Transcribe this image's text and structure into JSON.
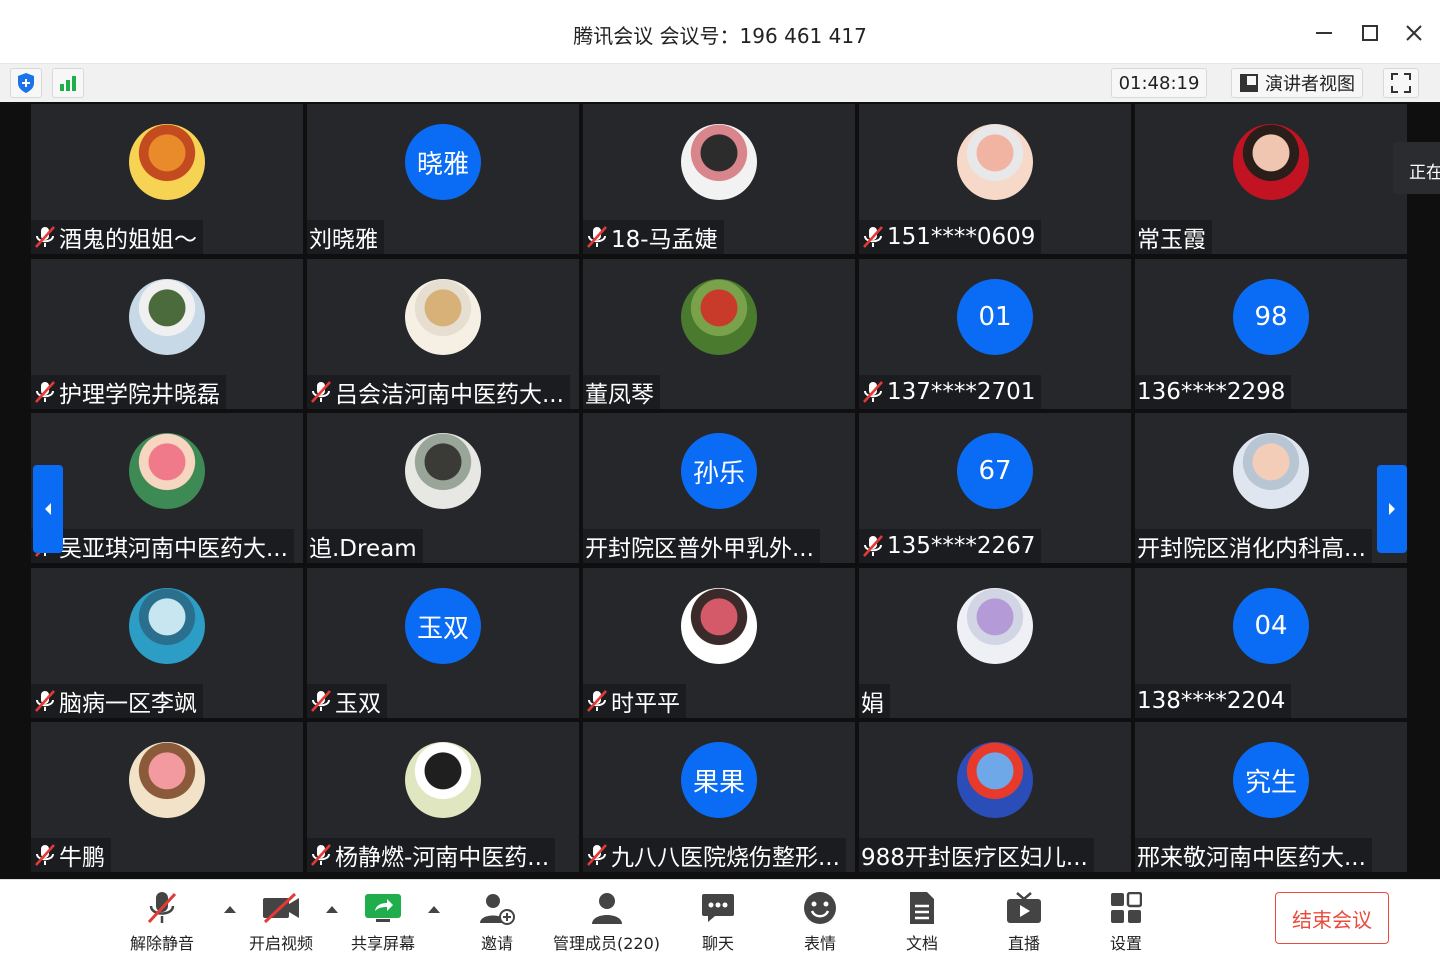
{
  "window": {
    "title": "腾讯会议 会议号：196 461 417"
  },
  "infobar": {
    "timer": "01:48:19",
    "presenter_view": "演讲者视图"
  },
  "speaking_label": "正在",
  "tiles": [
    {
      "name": "酒鬼的姐姐～",
      "muted": true,
      "avatar": "photo",
      "avatar_colors": [
        "#f7d354",
        "#e98b2a",
        "#c44a20"
      ]
    },
    {
      "name": "刘晓雅",
      "muted": false,
      "avatar": "text",
      "avatar_text": "晓雅"
    },
    {
      "name": "18-马孟婕",
      "muted": true,
      "avatar": "photo",
      "avatar_colors": [
        "#f2f2f2",
        "#2c2c2c",
        "#d8858c"
      ]
    },
    {
      "name": "151****0609",
      "muted": true,
      "avatar": "photo",
      "avatar_colors": [
        "#f6d9c9",
        "#f1b3a2",
        "#e8e8ea"
      ]
    },
    {
      "name": "常玉霞",
      "muted": false,
      "avatar": "photo",
      "avatar_colors": [
        "#c21322",
        "#f0c6b0",
        "#2a1e1a"
      ]
    },
    {
      "name": "护理学院井晓磊",
      "muted": true,
      "avatar": "photo",
      "avatar_colors": [
        "#c7d8e6",
        "#4b6b3c",
        "#f0f0f0"
      ]
    },
    {
      "name": "吕会洁河南中医药大...",
      "muted": true,
      "avatar": "photo",
      "avatar_colors": [
        "#f6efe3",
        "#d7b178",
        "#e7ded2"
      ]
    },
    {
      "name": "董凤琴",
      "muted": false,
      "avatar": "photo",
      "avatar_colors": [
        "#4a7a2e",
        "#c83a2a",
        "#7aa24a"
      ]
    },
    {
      "name": "137****2701",
      "muted": true,
      "avatar": "text",
      "avatar_text": "01"
    },
    {
      "name": "136****2298",
      "muted": false,
      "avatar": "text",
      "avatar_text": "98"
    },
    {
      "name": "吴亚琪河南中医药大...",
      "muted": true,
      "avatar": "photo",
      "avatar_colors": [
        "#3e8a54",
        "#f07a8a",
        "#f6d6c0"
      ]
    },
    {
      "name": "追.Dream",
      "muted": false,
      "avatar": "photo",
      "avatar_colors": [
        "#e7e7e4",
        "#3a3a36",
        "#9aa59a"
      ]
    },
    {
      "name": "开封院区普外甲乳外...",
      "muted": false,
      "avatar": "text",
      "avatar_text": "孙乐"
    },
    {
      "name": "135****2267",
      "muted": true,
      "avatar": "text",
      "avatar_text": "67"
    },
    {
      "name": "开封院区消化内科高...",
      "muted": false,
      "avatar": "photo",
      "avatar_colors": [
        "#dfe6f0",
        "#f3cdb8",
        "#b8c6d4"
      ]
    },
    {
      "name": "脑病一区李飒",
      "muted": true,
      "avatar": "photo",
      "avatar_colors": [
        "#2c9dc4",
        "#c8e6f0",
        "#2b6f8e"
      ]
    },
    {
      "name": "玉双",
      "muted": true,
      "avatar": "text",
      "avatar_text": "玉双"
    },
    {
      "name": "时平平",
      "muted": true,
      "avatar": "photo",
      "avatar_colors": [
        "#ffffff",
        "#d45a6a",
        "#3a2a2a"
      ]
    },
    {
      "name": "娟",
      "muted": false,
      "avatar": "photo",
      "avatar_colors": [
        "#eef0f6",
        "#b49ad6",
        "#d2d6e4"
      ]
    },
    {
      "name": "138****2204",
      "muted": false,
      "avatar": "text",
      "avatar_text": "04"
    },
    {
      "name": "牛鹏",
      "muted": true,
      "avatar": "photo",
      "avatar_colors": [
        "#f2e3c8",
        "#f29aa0",
        "#8a5a3a"
      ]
    },
    {
      "name": "杨静燃-河南中医药...",
      "muted": true,
      "avatar": "photo",
      "avatar_colors": [
        "#e0e6c0",
        "#1f1f1f",
        "#ffffff"
      ]
    },
    {
      "name": "九八八医院烧伤整形...",
      "muted": true,
      "avatar": "text",
      "avatar_text": "果果"
    },
    {
      "name": "988开封医疗区妇儿...",
      "muted": false,
      "avatar": "photo",
      "avatar_colors": [
        "#2a4db8",
        "#6fa8e8",
        "#e83a2a"
      ]
    },
    {
      "name": "邢来敬河南中医药大...",
      "muted": false,
      "avatar": "text",
      "avatar_text": "究生"
    }
  ],
  "toolbar": {
    "unmute": "解除静音",
    "video": "开启视频",
    "share": "共享屏幕",
    "invite": "邀请",
    "members": "管理成员(220)",
    "chat": "聊天",
    "emoji": "表情",
    "docs": "文档",
    "live": "直播",
    "settings": "设置",
    "end": "结束会议"
  },
  "colors": {
    "accent": "#0a6cf4",
    "danger": "#e94b3c",
    "tile_bg": "#26272b"
  }
}
